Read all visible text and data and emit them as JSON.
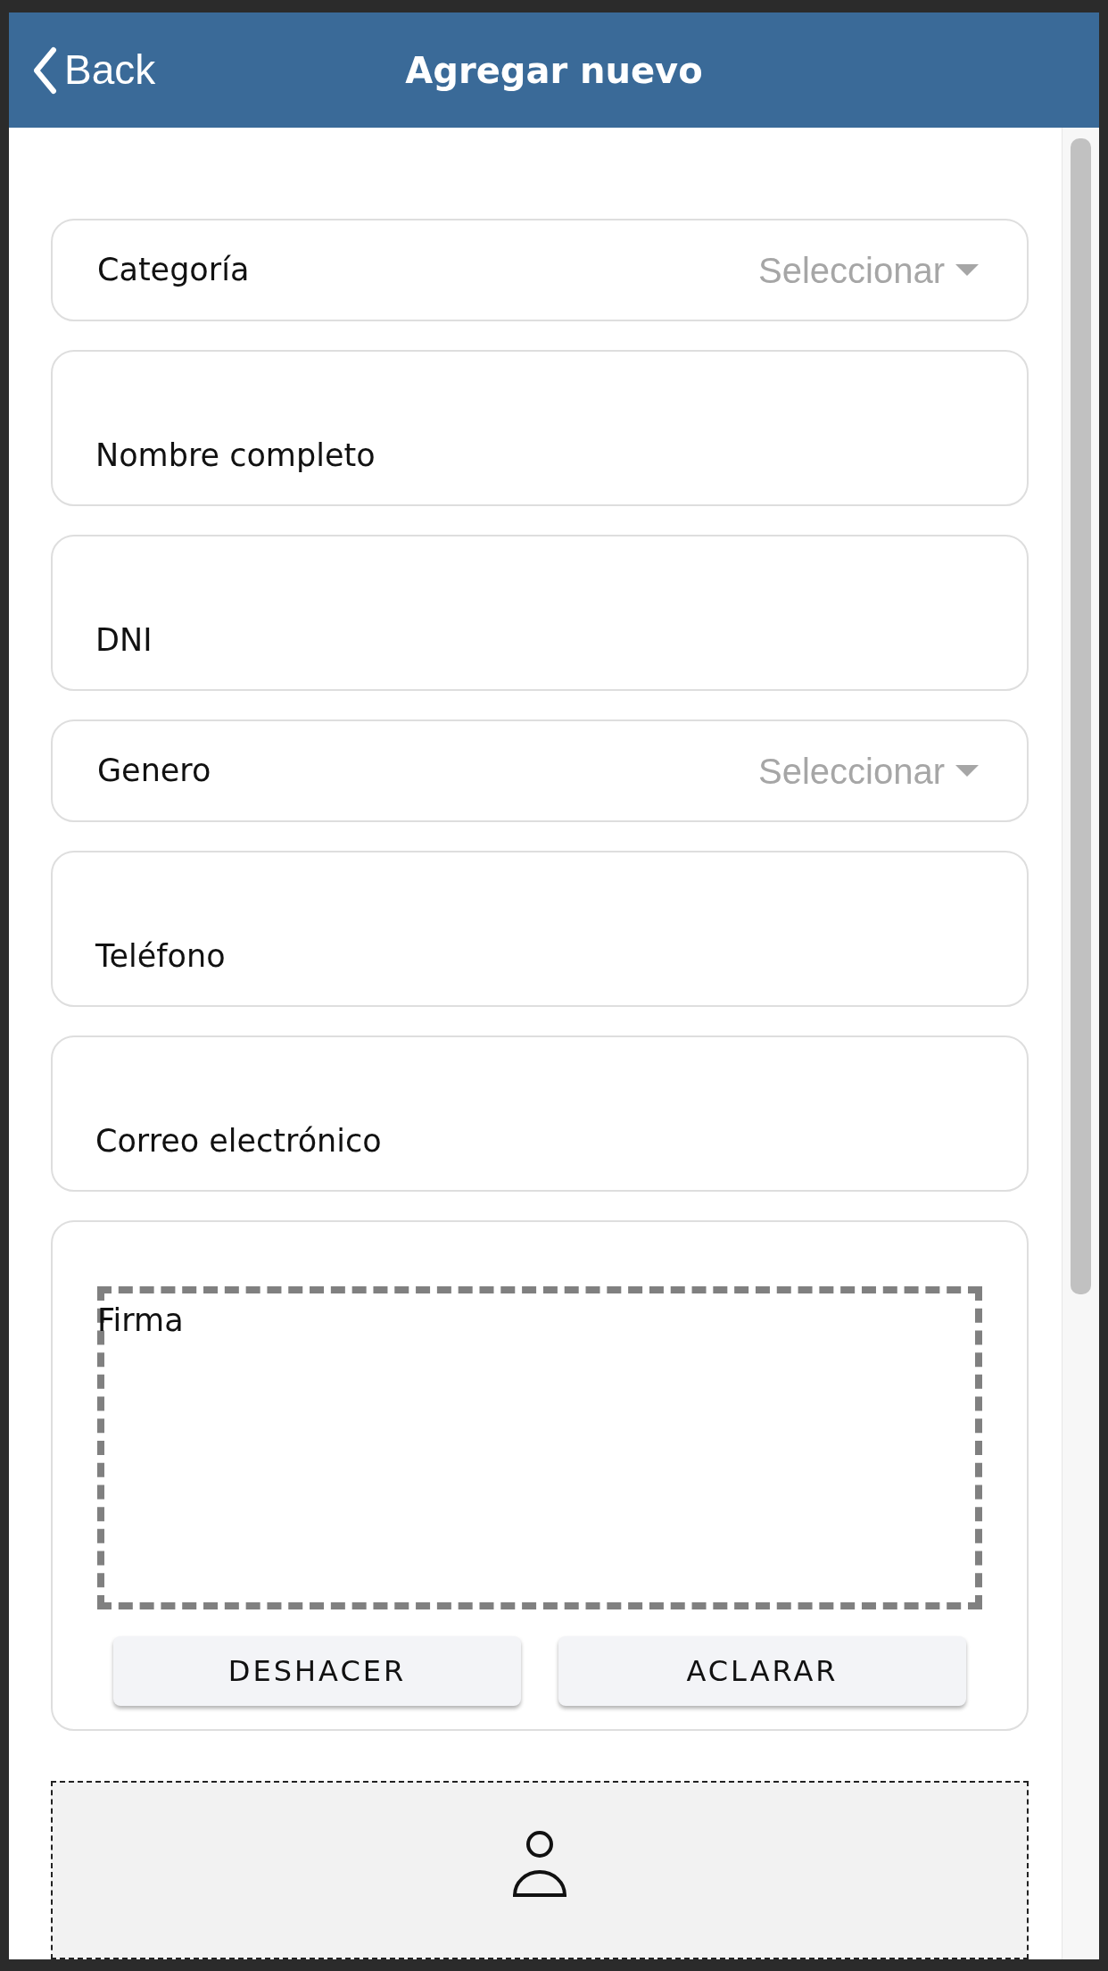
{
  "header": {
    "back_label": "Back",
    "title": "Agregar nuevo"
  },
  "fields": [
    {
      "kind": "select",
      "label": "Categoría",
      "placeholder": "Seleccionar"
    },
    {
      "kind": "text",
      "label": "Nombre completo"
    },
    {
      "kind": "text",
      "label": "DNI"
    },
    {
      "kind": "select",
      "label": "Genero",
      "placeholder": "Seleccionar"
    },
    {
      "kind": "text",
      "label": "Teléfono"
    },
    {
      "kind": "text",
      "label": "Correo electrónico"
    }
  ],
  "signature": {
    "label": "Firma",
    "buttons": [
      "DESHACER",
      "ACLARAR"
    ]
  }
}
